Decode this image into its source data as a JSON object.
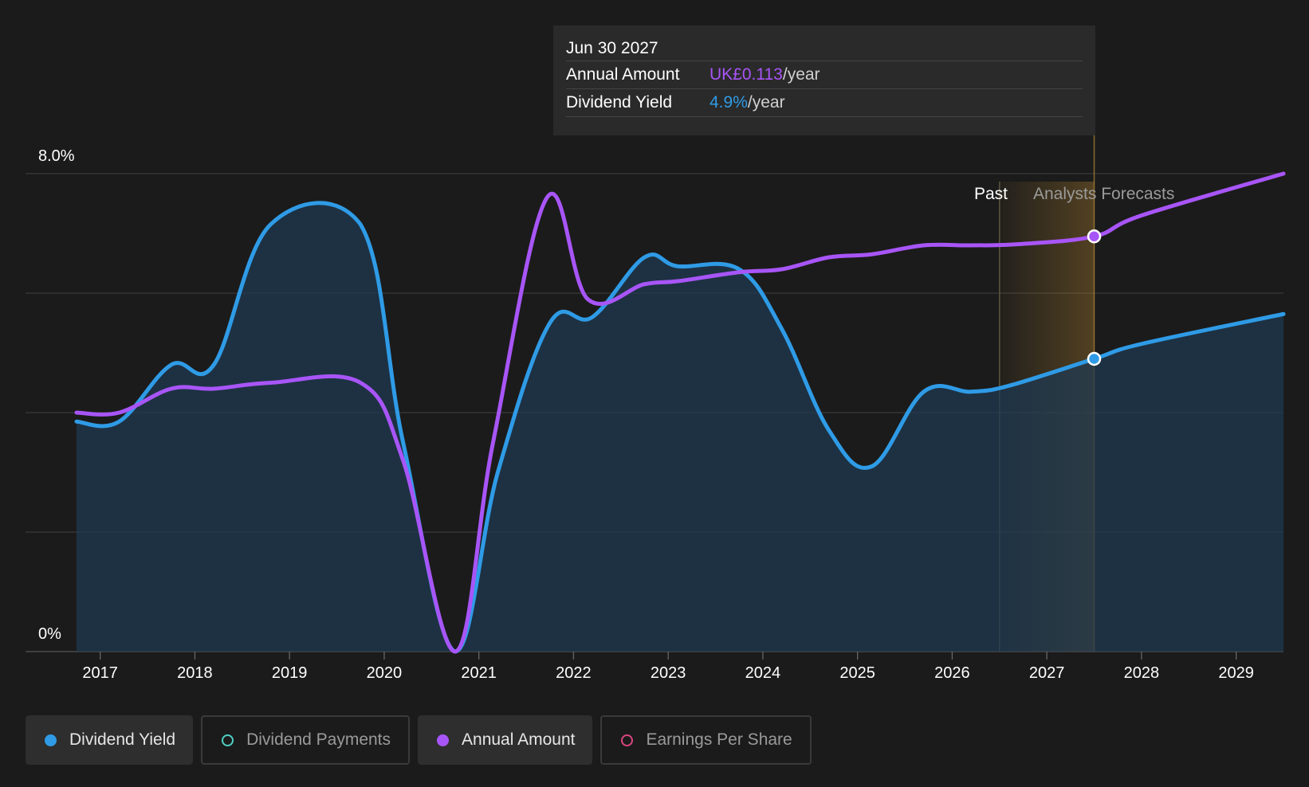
{
  "tooltip": {
    "date": "Jun 30 2027",
    "annual_label": "Annual Amount",
    "annual_value": "UK£0.113",
    "annual_unit": "/year",
    "yield_label": "Dividend Yield",
    "yield_value": "4.9%",
    "yield_unit": "/year"
  },
  "region_labels": {
    "past": "Past",
    "forecast": "Analysts Forecasts"
  },
  "legend": [
    {
      "label": "Dividend Yield",
      "active": true,
      "color": "#2f9be6",
      "filled": true
    },
    {
      "label": "Dividend Payments",
      "active": false,
      "color": "#4fd1c5",
      "filled": false
    },
    {
      "label": "Annual Amount",
      "active": true,
      "color": "#a855f7",
      "filled": true
    },
    {
      "label": "Earnings Per Share",
      "active": false,
      "color": "#d9467f",
      "filled": false
    }
  ],
  "colors": {
    "yield": "#2f9be6",
    "annual": "#a855f7",
    "grid": "#3a3a3a",
    "forecast_band": "#b8862e"
  },
  "chart_data": {
    "type": "line",
    "title": "",
    "xlabel": "",
    "ylabel": "",
    "y_tick_labels": [
      "8.0%",
      "0%"
    ],
    "ylim": [
      0,
      8
    ],
    "xlim": [
      2016.75,
      2029.5
    ],
    "x_ticks": [
      2017,
      2018,
      2019,
      2020,
      2021,
      2022,
      2023,
      2024,
      2025,
      2026,
      2027,
      2028,
      2029
    ],
    "past_until": 2026.5,
    "forecast_marker": 2027.5,
    "grid": true,
    "series": [
      {
        "name": "Dividend Yield",
        "points": [
          [
            2016.75,
            3.85
          ],
          [
            2017.2,
            3.85
          ],
          [
            2017.75,
            4.8
          ],
          [
            2018.2,
            4.8
          ],
          [
            2018.8,
            7.15
          ],
          [
            2019.75,
            7.15
          ],
          [
            2020.2,
            3.5
          ],
          [
            2020.75,
            0.0
          ],
          [
            2021.2,
            3.0
          ],
          [
            2021.75,
            5.5
          ],
          [
            2022.2,
            5.6
          ],
          [
            2022.75,
            6.6
          ],
          [
            2023.1,
            6.45
          ],
          [
            2023.75,
            6.4
          ],
          [
            2024.2,
            5.4
          ],
          [
            2024.7,
            3.7
          ],
          [
            2025.15,
            3.1
          ],
          [
            2025.7,
            4.35
          ],
          [
            2026.2,
            4.35
          ],
          [
            2026.6,
            4.45
          ],
          [
            2027.5,
            4.9
          ],
          [
            2028.0,
            5.15
          ],
          [
            2029.5,
            5.65
          ]
        ]
      },
      {
        "name": "Annual Amount",
        "points": [
          [
            2016.75,
            4.0
          ],
          [
            2017.2,
            4.0
          ],
          [
            2017.75,
            4.4
          ],
          [
            2018.2,
            4.4
          ],
          [
            2018.8,
            4.5
          ],
          [
            2019.75,
            4.5
          ],
          [
            2020.2,
            3.2
          ],
          [
            2020.75,
            0.0
          ],
          [
            2021.15,
            3.5
          ],
          [
            2021.72,
            7.6
          ],
          [
            2022.15,
            5.9
          ],
          [
            2022.75,
            6.15
          ],
          [
            2023.1,
            6.2
          ],
          [
            2023.75,
            6.35
          ],
          [
            2024.2,
            6.4
          ],
          [
            2024.7,
            6.6
          ],
          [
            2025.15,
            6.65
          ],
          [
            2025.7,
            6.8
          ],
          [
            2026.2,
            6.8
          ],
          [
            2026.7,
            6.82
          ],
          [
            2027.5,
            6.95
          ],
          [
            2028.0,
            7.3
          ],
          [
            2029.5,
            8.0
          ]
        ]
      }
    ]
  }
}
